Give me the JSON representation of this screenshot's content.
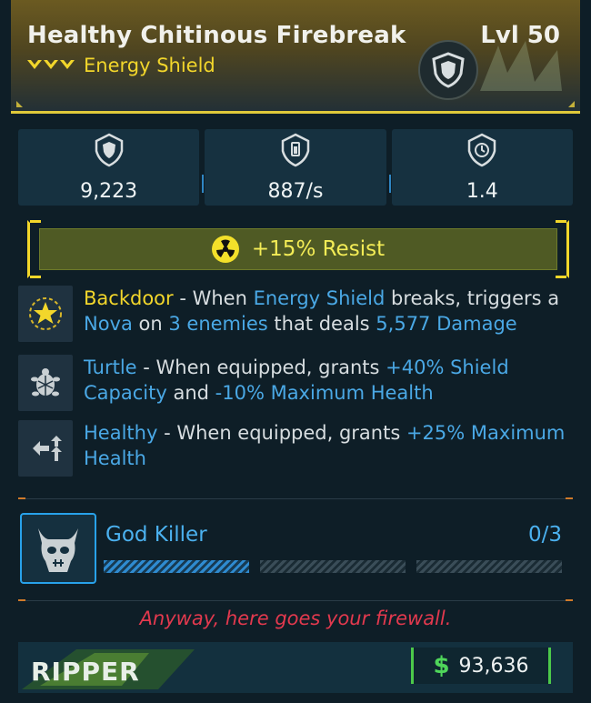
{
  "item": {
    "name": "Healthy Chitinous Firebreak",
    "level": "Lvl 50",
    "type": "Energy Shield",
    "rarity_icon": "rarity-chevrons-icon",
    "accent_color": "#f2d62b"
  },
  "stats": [
    {
      "icon": "shield-capacity-icon",
      "value": "9,223"
    },
    {
      "icon": "recharge-rate-icon",
      "value": "887/s"
    },
    {
      "icon": "recharge-delay-icon",
      "value": "1.4"
    }
  ],
  "resist": {
    "icon": "radiation-icon",
    "text": "+15% Resist"
  },
  "perks": [
    {
      "icon": "star-burst-icon",
      "name": "Backdoor",
      "parts": [
        " - When ",
        "Energy Shield",
        " breaks, triggers a ",
        "Nova",
        " on ",
        "3 enemies",
        " that deals ",
        "5,577 Damage"
      ]
    },
    {
      "icon": "turtle-icon",
      "name": "Turtle",
      "parts": [
        " - When equipped, grants ",
        "+40% Shield Capacity",
        " and ",
        "-10% Maximum Health"
      ]
    },
    {
      "icon": "health-arrows-icon",
      "name": "Healthy",
      "parts": [
        " - When equipped, grants ",
        "+25% Maximum Health"
      ]
    }
  ],
  "challenge": {
    "icon": "god-killer-skull-icon",
    "name": "God Killer",
    "progress_text": "0/3",
    "progress": 0
  },
  "flavor_text": "Anyway, here goes your firewall.",
  "footer": {
    "manufacturer_logo_text": "RIPPER",
    "currency_symbol": "$",
    "price": "93,636",
    "price_color": "#4fd65a"
  }
}
